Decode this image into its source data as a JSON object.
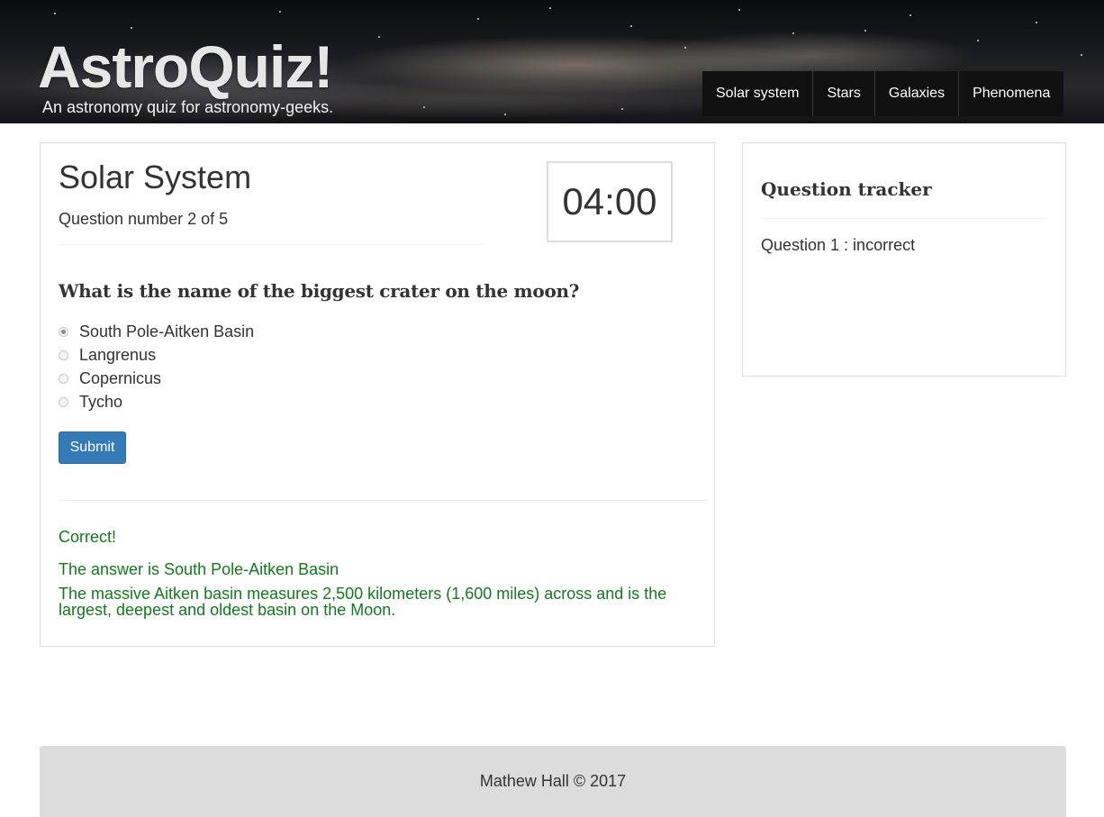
{
  "header": {
    "brand_title": "AstroQuiz!",
    "tagline": "An astronomy quiz for astronomy-geeks.",
    "nav": [
      {
        "label": "Solar system"
      },
      {
        "label": "Stars"
      },
      {
        "label": "Galaxies"
      },
      {
        "label": "Phenomena"
      }
    ]
  },
  "quiz": {
    "title": "Solar System",
    "question_number": "Question number 2 of 5",
    "timer": "04:00",
    "question": "What is the name of the biggest crater on the moon?",
    "options": [
      {
        "label": "South Pole-Aitken Basin",
        "selected": true
      },
      {
        "label": "Langrenus",
        "selected": false
      },
      {
        "label": "Copernicus",
        "selected": false
      },
      {
        "label": "Tycho",
        "selected": false
      }
    ],
    "submit_label": "Submit",
    "feedback": {
      "status": "Correct!",
      "answer": "The answer is South Pole-Aitken Basin",
      "explanation": "The massive Aitken basin measures 2,500 kilometers (1,600 miles) across and is the largest, deepest and oldest basin on the Moon."
    }
  },
  "tracker": {
    "title": "Question tracker",
    "items": [
      {
        "label": "Question 1 : incorrect"
      }
    ]
  },
  "footer": {
    "text": "Mathew Hall © 2017"
  },
  "colors": {
    "nav_background": "#111111",
    "primary_button": "#337ab7",
    "feedback_green": "#127a1a",
    "footer_background": "#dcdcdc"
  }
}
